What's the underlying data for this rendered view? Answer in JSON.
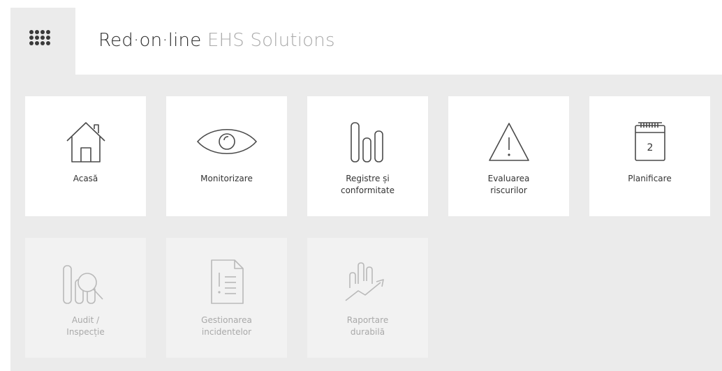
{
  "header": {
    "brand_primary": "Red·on·line",
    "brand_secondary": "EHS Solutions",
    "apps_icon": "grid-icon"
  },
  "tiles": [
    {
      "label": "Acasă",
      "icon": "home-icon",
      "enabled": true
    },
    {
      "label": "Monitorizare",
      "icon": "eye-icon",
      "enabled": true
    },
    {
      "label": "Registre și\nconformitate",
      "icon": "bars-icon",
      "enabled": true
    },
    {
      "label": "Evaluarea\nriscurilor",
      "icon": "warning-icon",
      "enabled": true
    },
    {
      "label": "Planificare",
      "icon": "calendar-icon",
      "enabled": true,
      "calendar_day": "2"
    },
    {
      "label": "Audit /\nInspecție",
      "icon": "audit-search-icon",
      "enabled": false
    },
    {
      "label": "Gestionarea\nincidentelor",
      "icon": "incident-document-icon",
      "enabled": false
    },
    {
      "label": "Raportare\ndurabilă",
      "icon": "growth-chart-icon",
      "enabled": false
    }
  ]
}
